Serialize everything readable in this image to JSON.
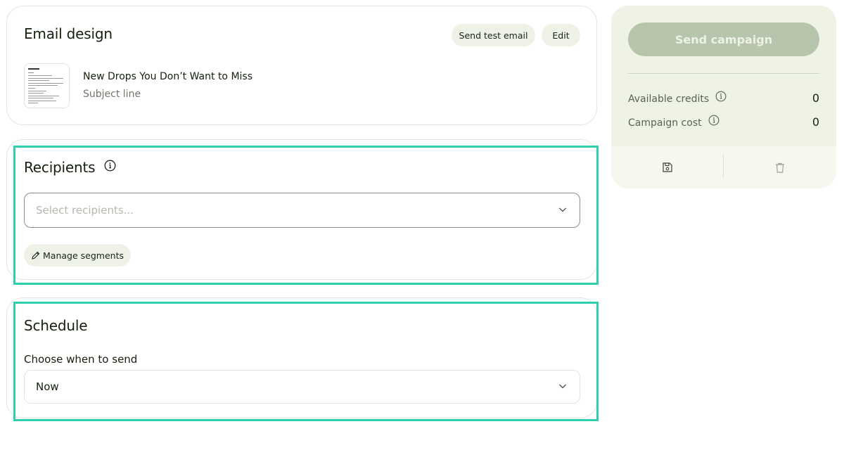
{
  "email_design": {
    "title": "Email design",
    "send_test_label": "Send test email",
    "edit_label": "Edit",
    "subject": "New Drops You Don’t Want to Miss",
    "subject_caption": "Subject line"
  },
  "recipients": {
    "title": "Recipients",
    "select_placeholder": "Select recipients...",
    "manage_segments_label": "Manage segments"
  },
  "schedule": {
    "title": "Schedule",
    "field_label": "Choose when to send",
    "selected_value": "Now"
  },
  "sidebar": {
    "send_campaign_label": "Send campaign",
    "available_credits_label": "Available credits",
    "available_credits_value": "0",
    "campaign_cost_label": "Campaign cost",
    "campaign_cost_value": "0"
  },
  "colors": {
    "accent_highlight": "#2fcfae",
    "pill_bg": "#eef2e6",
    "sidebar_bg": "#eff3e6",
    "disabled_button": "#b8c5ad"
  },
  "icons": [
    "info-icon",
    "chevron-down-icon",
    "pencil-icon",
    "save-icon",
    "trash-icon"
  ]
}
